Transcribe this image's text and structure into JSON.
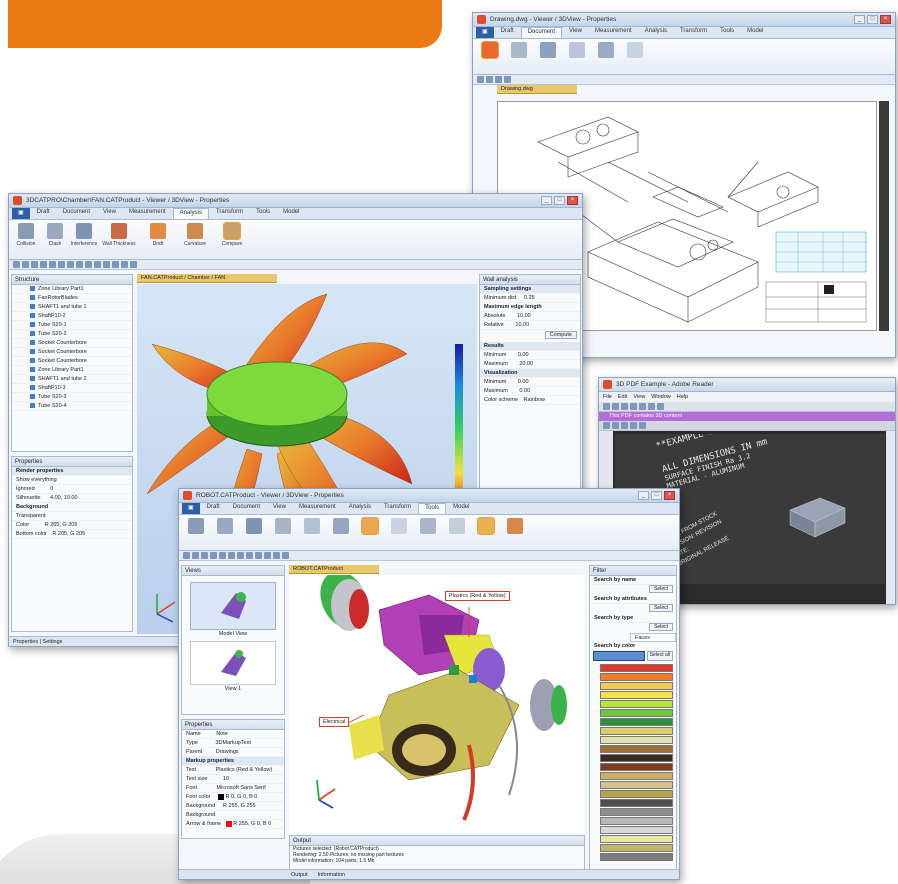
{
  "fan_window": {
    "title": "3DCATPRO\\Chamber\\FAN.CATProduct - Viewer / 3DView - Properties",
    "tabs": [
      {
        "label": "Draft"
      },
      {
        "label": "Document"
      },
      {
        "label": "View"
      },
      {
        "label": "Measurement"
      },
      {
        "label": "Analysis"
      },
      {
        "label": "Transform"
      },
      {
        "label": "Tools"
      },
      {
        "label": "Model"
      }
    ],
    "ribbon": [
      {
        "label": "Collision",
        "color": "#8c9bb5"
      },
      {
        "label": "Clash",
        "color": "#9ba8c1"
      },
      {
        "label": "Interference",
        "color": "#7f93b3"
      },
      {
        "label": "Wall Thickness",
        "color": "#c96c46"
      },
      {
        "label": "Draft",
        "color": "#e28a3f"
      },
      {
        "label": "Curvature",
        "color": "#d08a4b"
      },
      {
        "label": "Compare",
        "color": "#caa169"
      }
    ],
    "document_tab": "FAN.CATProduct / Chamber / FAN",
    "structure": {
      "title": "Structure",
      "items": [
        "Zone Library Part1",
        "FanRotorBlades",
        "SHAFT1 and tube 1",
        "ShaftP10-2",
        "Tube S20-1",
        "Tube S20-2",
        "Socket Counterbore",
        "Socket Counterbore",
        "Socket Counterbore",
        "Zone Library Part1",
        "SHAFT1 and tube 2",
        "ShaftP10-3",
        "Tube S20-3",
        "Tube S20-4"
      ]
    },
    "properties": {
      "title": "Properties",
      "header": "Render properties",
      "rows": [
        {
          "name": "Show everything",
          "value": ""
        },
        {
          "name": "Ignored",
          "value": "0"
        },
        {
          "name": "Silhouette",
          "value": "4.00, 10.00"
        },
        {
          "name": "Background",
          "value": ""
        },
        {
          "name": "Transparent",
          "value": ""
        },
        {
          "name": "Color",
          "value": "R 205, G 205"
        },
        {
          "name": "Bottom color",
          "value": "R 205, G 205"
        }
      ]
    },
    "analysis": {
      "title": "Wall analysis",
      "groups": [
        {
          "title": "Sampling settings",
          "rows": [
            {
              "name": "Minimum dist",
              "value": "0.25"
            },
            {
              "name": "Maximum edge length",
              "value": ""
            },
            {
              "name": "Absolute",
              "value": "10.00"
            },
            {
              "name": "Relative",
              "value": "10.00"
            }
          ]
        },
        {
          "title": "Results",
          "rows": [
            {
              "name": "Minimum",
              "value": "0.00"
            },
            {
              "name": "Maximum",
              "value": "20.00"
            }
          ]
        },
        {
          "title": "Visualization",
          "rows": [
            {
              "name": "Minimum",
              "value": "0.00"
            },
            {
              "name": "Maximum",
              "value": "0.00"
            },
            {
              "name": "Color scheme",
              "value": "Rainbow"
            }
          ]
        }
      ],
      "compute_label": "Compute"
    },
    "status": "Properties  |  Settings"
  },
  "drawing_window": {
    "title": "Drawing.dwg - Viewer / 3DView - Properties",
    "tabs": [
      {
        "label": "Draft"
      },
      {
        "label": "Document"
      },
      {
        "label": "View"
      },
      {
        "label": "Measurement"
      },
      {
        "label": "Analysis"
      },
      {
        "label": "Transform"
      },
      {
        "label": "Tools"
      },
      {
        "label": "Model"
      }
    ],
    "doc_tab": "Drawing.dwg"
  },
  "pdf_window": {
    "title": "3D PDF Example - Adobe Reader",
    "menu": [
      {
        "label": "File"
      },
      {
        "label": "Edit"
      },
      {
        "label": "View"
      },
      {
        "label": "Window"
      },
      {
        "label": "Help"
      }
    ],
    "notice": "This PDF contains 3D content",
    "lines": [
      "**EXAMPLE PART ONLY - NOT FOR MFG**",
      "ALL DIMENSIONS IN mm",
      "SURFACE FINISH Ra 3.2",
      "MATERIAL - ALUMINUM"
    ],
    "side_lines": [
      "NOTES:",
      "MADE FROM STOCK",
      "VERSION: REVISION",
      "DATE:",
      "ORIGINAL RELEASE"
    ]
  },
  "robot_window": {
    "title": "ROBOT.CATProduct - Viewer / 3DView - Properties",
    "tabs": [
      {
        "label": "Draft"
      },
      {
        "label": "Document"
      },
      {
        "label": "View"
      },
      {
        "label": "Measurement"
      },
      {
        "label": "Analysis"
      },
      {
        "label": "Transform"
      },
      {
        "label": "Tools"
      },
      {
        "label": "Model"
      }
    ],
    "views_panel": {
      "title": "Views",
      "items": [
        {
          "label": "Model View"
        },
        {
          "label": "View 1"
        }
      ]
    },
    "doc_tab": "ROBOT.CATProduct",
    "callout_main": "Plastics (Red & Yellow)",
    "callout_small": "Electrical",
    "filter": {
      "title": "Filter",
      "search_name": "Search by name",
      "search_attributes": "Search by attributes",
      "search_type": "Search by type",
      "search_color": "Search by color",
      "select": "Select",
      "type_value": "Faces",
      "select_all": "Select all"
    },
    "properties": {
      "title": "Properties",
      "rows": [
        {
          "name": "Name",
          "value": "Note"
        },
        {
          "name": "Type",
          "value": "3DMarkupText"
        },
        {
          "name": "Parent",
          "value": "Drawings"
        }
      ],
      "header": "Markup properties",
      "props": [
        {
          "name": "Text",
          "value": "Plastics (Red & Yellow)"
        },
        {
          "name": "Text size",
          "value": "10"
        },
        {
          "name": "Font",
          "value": "Microsoft Sans Serif"
        },
        {
          "name": "Font color",
          "value": "R 0, G 0, B 0"
        },
        {
          "name": "Background",
          "value": "R 255, G 255"
        },
        {
          "name": "Background",
          "value": ""
        },
        {
          "name": "Arrow & frame",
          "value": "R 255, G 0, B 0"
        }
      ]
    },
    "output": {
      "title": "Output",
      "lines": [
        "Pictures selected: (Robot.CATProduct)",
        "Rendering: 2.50 Pictures, no missing part textures",
        "Model information: 104 parts, 1.5 Mb"
      ]
    },
    "bottom_tabs": [
      {
        "label": "Output"
      },
      {
        "label": "Information"
      }
    ],
    "palette_colors": [
      "#e03a2e",
      "#f07c2b",
      "#f4c94e",
      "#f7e04d",
      "#b8e53a",
      "#6fc741",
      "#2f8f3c",
      "#d9cf6d",
      "#e2e2b0",
      "#9c6f36",
      "#3b2b20",
      "#7e3d1f",
      "#c9b06a",
      "#d4c08a",
      "#b7a24f",
      "#4f4f4f",
      "#8e8e8e",
      "#b6b6b6",
      "#d8d8d8",
      "#e8e8a6",
      "#c4b36c",
      "#7c7c7c"
    ]
  },
  "colors": {
    "orange_header": "#ec7a12",
    "ribbon_blue": "#2d5fa8",
    "pdf_purple": "#b46cd8",
    "pdf_dark": "#3a3a3a"
  }
}
